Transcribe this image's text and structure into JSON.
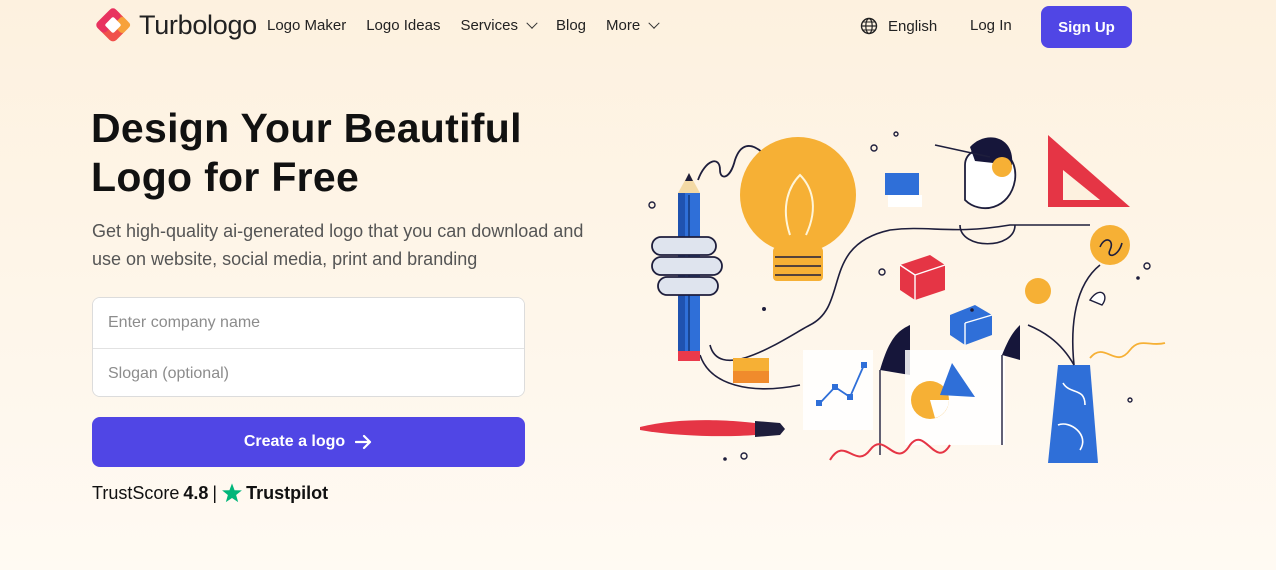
{
  "brand": {
    "name": "Turbologo"
  },
  "nav": {
    "items": [
      {
        "label": "Logo Maker",
        "dropdown": false
      },
      {
        "label": "Logo Ideas",
        "dropdown": false
      },
      {
        "label": "Services",
        "dropdown": true
      },
      {
        "label": "Blog",
        "dropdown": false
      },
      {
        "label": "More",
        "dropdown": true
      }
    ],
    "language": "English",
    "login": "Log In",
    "signup": "Sign Up"
  },
  "hero": {
    "title_line1": "Design Your Beautiful",
    "title_line2": "Logo for Free",
    "subtitle_line1": "Get high-quality ai-generated logo that you can download and",
    "subtitle_line2": "use on website, social media, print and branding",
    "company_placeholder": "Enter company name",
    "slogan_placeholder": "Slogan (optional)",
    "cta_label": "Create a logo",
    "trust_prefix": "TrustScore",
    "trust_score": "4.8",
    "trust_sep": "|",
    "trust_brand": "Trustpilot"
  },
  "colors": {
    "accent": "#5046e5",
    "trustpilot": "#00b67a",
    "background": "#fdf1df"
  }
}
